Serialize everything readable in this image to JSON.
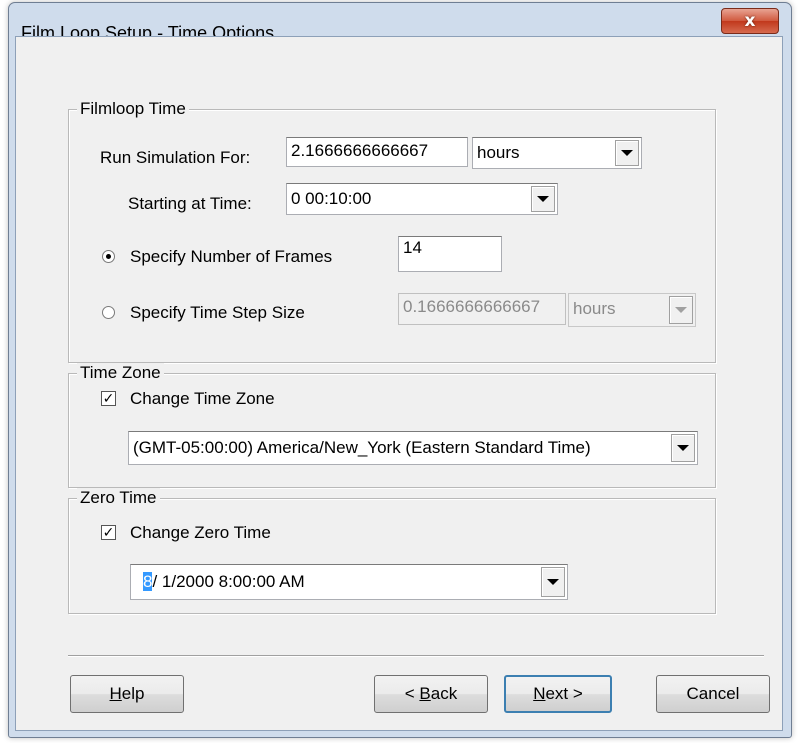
{
  "window": {
    "title": "Film Loop Setup - Time Options",
    "close_glyph": "x"
  },
  "filmloop_time": {
    "group_label": "Filmloop Time",
    "run_label": "Run Simulation For:",
    "run_value": "2.1666666666667",
    "run_units": "hours",
    "start_label": "Starting at Time:",
    "start_value": "0 00:10:00",
    "frames_label": "Specify Number of Frames",
    "frames_value": "14",
    "frames_selected": true,
    "step_label": "Specify Time Step Size",
    "step_value": "0.1666666666667",
    "step_units": "hours",
    "step_selected": false
  },
  "time_zone": {
    "group_label": "Time Zone",
    "checkbox_label": "Change Time Zone",
    "checked": true,
    "value": "(GMT-05:00:00) America/New_York (Eastern Standard Time)"
  },
  "zero_time": {
    "group_label": "Zero Time",
    "checkbox_label": "Change Zero Time",
    "checked": true,
    "month": "8",
    "rest": "/  1/2000   8:00:00 AM"
  },
  "buttons": {
    "help": {
      "accel": "H",
      "rest": "elp"
    },
    "back": {
      "prefix": "< ",
      "accel": "B",
      "rest": "ack"
    },
    "next": {
      "accel": "N",
      "rest": "ext >"
    },
    "cancel": "Cancel"
  }
}
